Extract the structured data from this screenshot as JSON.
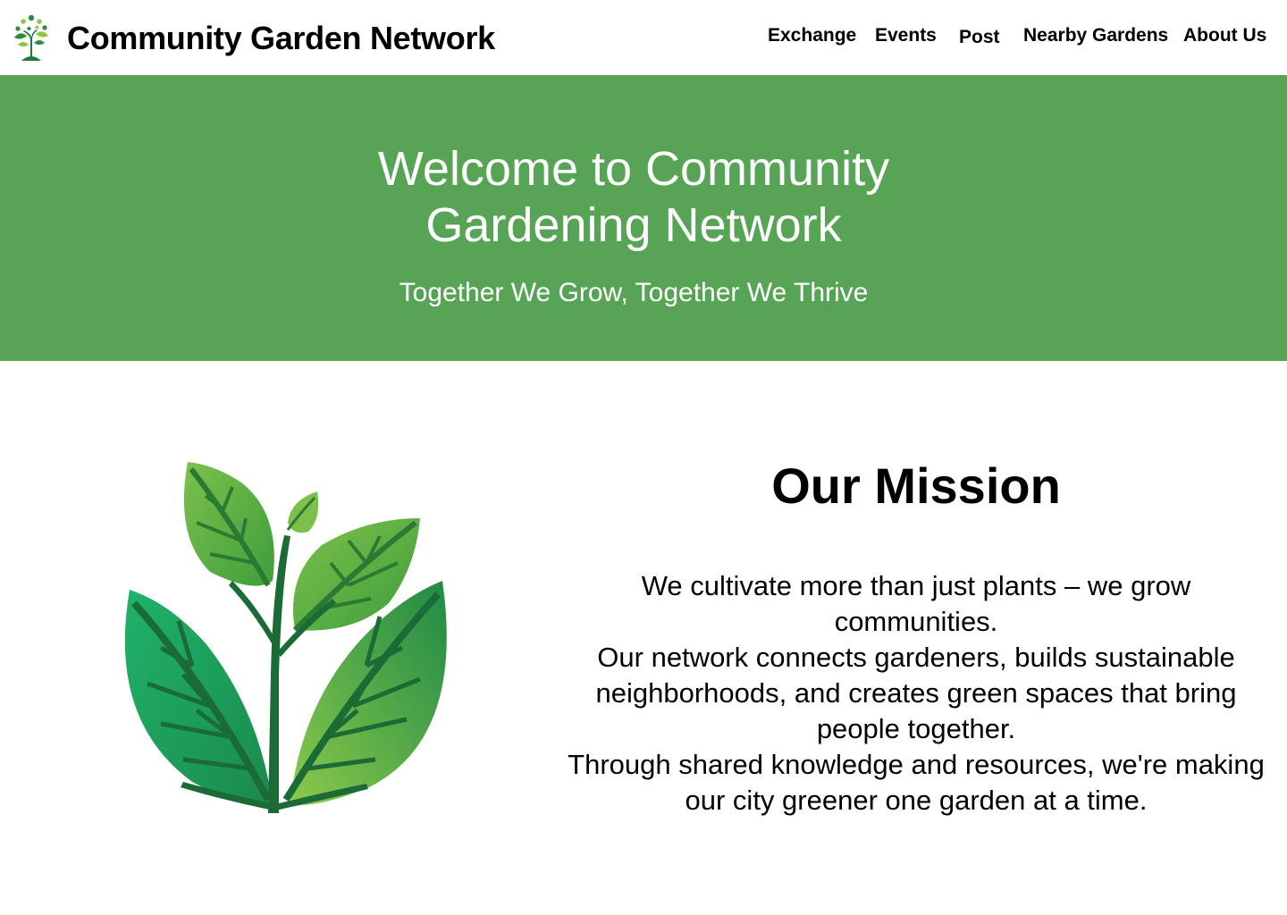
{
  "header": {
    "site_name": "Community Garden Network",
    "logo_icon": "tree-people-icon",
    "nav": [
      {
        "label": "Exchange"
      },
      {
        "label": "Events"
      },
      {
        "label": "Post"
      },
      {
        "label": "Nearby Gardens"
      },
      {
        "label": "About Us"
      }
    ]
  },
  "hero": {
    "title_line1": "Welcome to Community",
    "title_line2": "Gardening Network",
    "subtitle": "Together We Grow, Together We Thrive",
    "background_color": "#57a457"
  },
  "mission": {
    "image_icon": "leafy-plant-icon",
    "title": "Our Mission",
    "paragraphs": [
      "We cultivate more than just plants – we grow communities.",
      "Our network connects gardeners, builds sustainable neighborhoods, and creates green spaces that bring people together.",
      "Through shared knowledge and resources, we're making our city greener one garden at a time."
    ]
  }
}
